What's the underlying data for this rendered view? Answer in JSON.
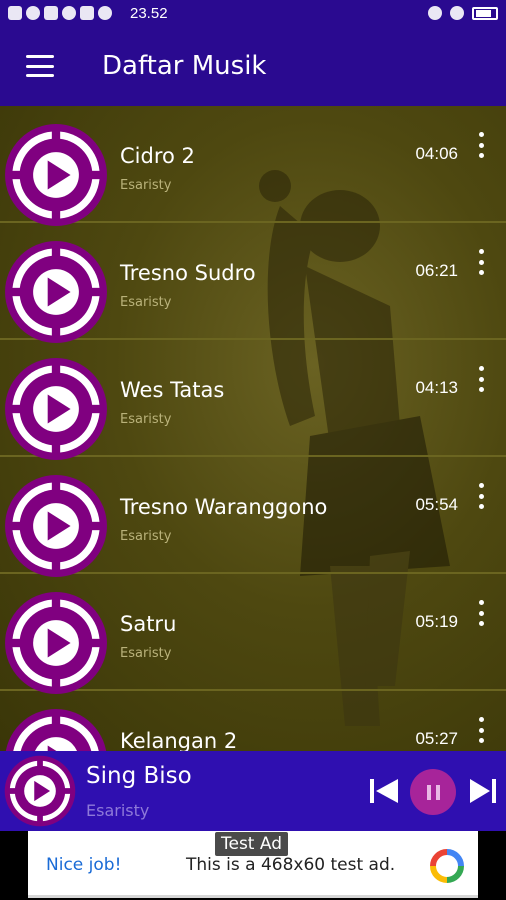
{
  "status_bar": {
    "time": "23.52"
  },
  "app_bar": {
    "title": "Daftar Musik",
    "menu_icon": "hamburger-menu-icon"
  },
  "songs": [
    {
      "title": "Cidro 2",
      "artist": "Esaristy",
      "duration": "04:06"
    },
    {
      "title": "Tresno Sudro",
      "artist": "Esaristy",
      "duration": "06:21"
    },
    {
      "title": "Wes Tatas",
      "artist": "Esaristy",
      "duration": "04:13"
    },
    {
      "title": "Tresno Waranggono",
      "artist": "Esaristy",
      "duration": "05:54"
    },
    {
      "title": "Satru",
      "artist": "Esaristy",
      "duration": "05:19"
    },
    {
      "title": "Kelangan 2",
      "artist": "Esaristy",
      "duration": "05:27"
    }
  ],
  "now_playing": {
    "title": "Sing Biso",
    "artist": "Esaristy",
    "state": "playing"
  },
  "ad": {
    "label": "Test Ad",
    "nice": "Nice job!",
    "text": "This is a 468x60 test ad."
  },
  "colors": {
    "app_bar": "#2a0a90",
    "now_playing": "#2f0fb0",
    "accent": "#800080",
    "pause_button": "#a7249a"
  }
}
